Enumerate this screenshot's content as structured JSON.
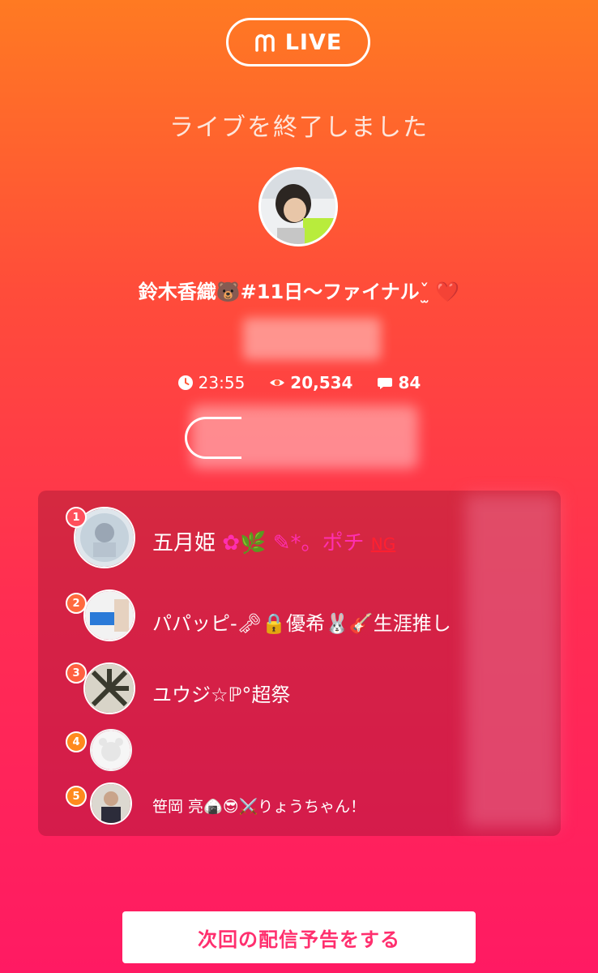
{
  "header": {
    "logo_label": "LIVE",
    "end_message": "ライブを終了しました"
  },
  "stream": {
    "title_text": "鈴木香織",
    "title_suffix": "#11日〜ファイナル",
    "emoji_bear": "🐻",
    "emoji_tie": "ˇ̫ ",
    "emoji_heart": "❤️"
  },
  "stats": {
    "duration": "23:55",
    "viewers": "20,534",
    "comments": "84"
  },
  "ranking": [
    {
      "rank": "1",
      "name": "五月姫",
      "deco": "✿🌿 ✎*。ポチ",
      "ng": "NG"
    },
    {
      "rank": "2",
      "name": "パパッピ-",
      "deco": "🗝🔒優希🐰🎸生涯推し"
    },
    {
      "rank": "3",
      "name": "ユウジ☆",
      "deco": "ℙ°超祭"
    },
    {
      "rank": "4",
      "name": "",
      "deco": ""
    },
    {
      "rank": "5",
      "name": "笹岡 亮",
      "deco": "🍙😎⚔️りょうちゃん！"
    }
  ],
  "cta": {
    "label": "次回の配信予告をする"
  },
  "colors": {
    "bg_top": "#ff7a22",
    "bg_bottom": "#ff1a63",
    "cta_text": "#ff2f6e"
  }
}
